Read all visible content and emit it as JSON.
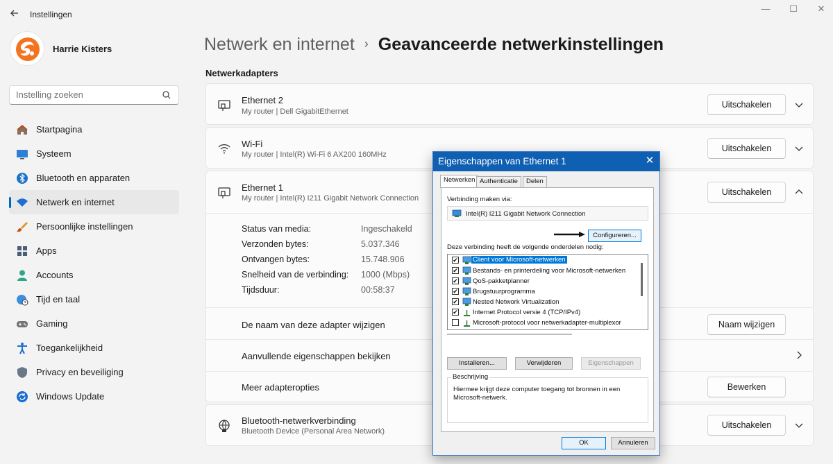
{
  "app": {
    "title": "Instellingen",
    "back_icon": "arrow-left-icon"
  },
  "window": {
    "minimize": "—",
    "maximize": "☐",
    "close": "✕"
  },
  "profile": {
    "name": "Harrie Kisters"
  },
  "search": {
    "placeholder": "Instelling zoeken"
  },
  "sidebar": {
    "items": [
      {
        "label": "Startpagina",
        "icon": "home-icon"
      },
      {
        "label": "Systeem",
        "icon": "monitor-icon"
      },
      {
        "label": "Bluetooth en apparaten",
        "icon": "bluetooth-icon"
      },
      {
        "label": "Netwerk en internet",
        "icon": "wifi-icon",
        "active": true
      },
      {
        "label": "Persoonlijke instellingen",
        "icon": "brush-icon"
      },
      {
        "label": "Apps",
        "icon": "apps-icon"
      },
      {
        "label": "Accounts",
        "icon": "person-icon"
      },
      {
        "label": "Tijd en taal",
        "icon": "globe-clock-icon"
      },
      {
        "label": "Gaming",
        "icon": "gamepad-icon"
      },
      {
        "label": "Toegankelijkheid",
        "icon": "accessibility-icon"
      },
      {
        "label": "Privacy en beveiliging",
        "icon": "shield-icon"
      },
      {
        "label": "Windows Update",
        "icon": "update-icon"
      }
    ]
  },
  "breadcrumb": {
    "parent": "Netwerk en internet",
    "separator": "›",
    "current": "Geavanceerde netwerkinstellingen"
  },
  "section": {
    "title": "Netwerkadapters"
  },
  "adapters": [
    {
      "name": "Ethernet 2",
      "desc": "My router | Dell GigabitEthernet",
      "button": "Uitschakelen"
    },
    {
      "name": "Wi-Fi",
      "desc": "My router | Intel(R) Wi-Fi 6 AX200 160MHz",
      "button": "Uitschakelen"
    },
    {
      "name": "Ethernet 1",
      "desc": "My router | Intel(R) I211 Gigabit Network Connection",
      "button": "Uitschakelen"
    }
  ],
  "ethernet1_details": [
    {
      "label": "Status van media:",
      "value": "Ingeschakeld"
    },
    {
      "label": "Verzonden bytes:",
      "value": "5.037.346"
    },
    {
      "label": "Ontvangen bytes:",
      "value": "15.748.906"
    },
    {
      "label": "Snelheid van de verbinding:",
      "value": "1000 (Mbps)"
    },
    {
      "label": "Tijdsduur:",
      "value": "00:58:37"
    }
  ],
  "ethernet1_actions": {
    "rename_label": "De naam van deze adapter wijzigen",
    "rename_button": "Naam wijzigen",
    "props_label": "Aanvullende eigenschappen bekijken",
    "more_label": "Meer adapteropties",
    "more_button": "Bewerken"
  },
  "bluetooth_adapter": {
    "name": "Bluetooth-netwerkverbinding",
    "desc": "Bluetooth Device (Personal Area Network)",
    "button": "Uitschakelen"
  },
  "dialog": {
    "title": "Eigenschappen van Ethernet 1",
    "tabs": [
      "Netwerken",
      "Authenticatie",
      "Delen"
    ],
    "connect_via_label": "Verbinding maken via:",
    "adapter_name": "Intel(R) I211 Gigabit Network Connection",
    "configure_button": "Configureren...",
    "components_label": "Deze verbinding heeft de volgende onderdelen nodig:",
    "components": [
      {
        "label": "Client voor Microsoft-netwerken",
        "checked": "✔",
        "icon": "network-client-icon",
        "selected": true
      },
      {
        "label": "Bestands- en printerdeling voor Microsoft-netwerken",
        "checked": "✔",
        "icon": "network-client-icon"
      },
      {
        "label": "QoS-pakketplanner",
        "checked": "✔",
        "icon": "network-client-icon"
      },
      {
        "label": "Brugstuurprogramma",
        "checked": "✔",
        "icon": "network-client-icon"
      },
      {
        "label": "Nested Network Virtualization",
        "checked": "✔",
        "icon": "network-client-icon"
      },
      {
        "label": "Internet Protocol versie 4 (TCP/IPv4)",
        "checked": "✔",
        "icon": "protocol-icon"
      },
      {
        "label": "Microsoft-protocol voor netwerkadapter-multiplexor",
        "checked": "",
        "icon": "protocol-icon"
      }
    ],
    "install_button": "Installeren...",
    "remove_button": "Verwijderen",
    "properties_button": "Eigenschappen",
    "description_title": "Beschrijving",
    "description_text": "Hiermee krijgt deze computer toegang tot bronnen in een Microsoft-netwerk.",
    "ok_button": "OK",
    "cancel_button": "Annuleren"
  },
  "colors": {
    "accent": "#0067c0",
    "dialog_title": "#0f5fb3",
    "selection": "#0078d7"
  }
}
